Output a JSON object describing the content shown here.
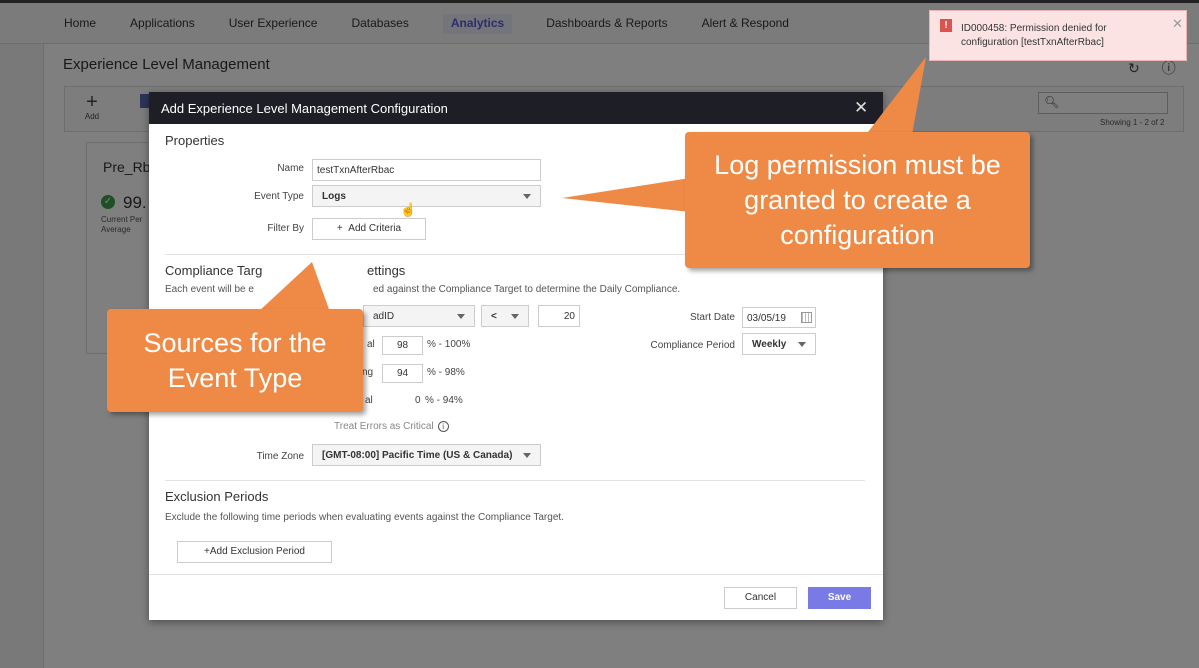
{
  "nav": {
    "items": [
      "Home",
      "Applications",
      "User Experience",
      "Databases",
      "Analytics",
      "Dashboards & Reports",
      "Alert & Respond"
    ],
    "active": "Analytics"
  },
  "page": {
    "title": "Experience Level Management",
    "add_label": "Add",
    "showing": "Showing 1 - 2 of 2"
  },
  "card": {
    "name": "Pre_Rb",
    "value": "99.",
    "sub_line1": "Current Per",
    "sub_line2": "Average"
  },
  "modal": {
    "title": "Add Experience Level Management Configuration",
    "properties_title": "Properties",
    "name_label": "Name",
    "name_value": "testTxnAfterRbac",
    "event_type_label": "Event Type",
    "event_type_value": "Logs",
    "filter_by_label": "Filter By",
    "add_criteria": "Add Criteria",
    "compliance_title": "Compliance Target Settings",
    "compliance_title_visible_left": "Compliance Targ",
    "compliance_title_visible_right": "ettings",
    "compliance_desc_left": "Each event will be e",
    "compliance_desc_right": "ed against the Compliance Target to determine the Daily Compliance.",
    "field_select_value": "adID",
    "operator_value": "<",
    "threshold_value": "20",
    "normal_partial": "al",
    "normal_value": "98",
    "normal_range": "% - 100%",
    "warning_partial": "ng",
    "warning_value": "94",
    "warning_range": "% - 98%",
    "critical_partial": "al",
    "critical_value": "0",
    "critical_range": "% - 94%",
    "treat_errors": "Treat Errors as Critical",
    "start_date_label": "Start Date",
    "start_date_value": "03/05/19",
    "compliance_period_label": "Compliance Period",
    "compliance_period_value": "Weekly",
    "time_zone_label": "Time Zone",
    "time_zone_value": "[GMT-08:00] Pacific Time (US & Canada)",
    "exclusion_title": "Exclusion Periods",
    "exclusion_desc": "Exclude the following time periods when evaluating events against the Compliance Target.",
    "add_exclusion": "Add Exclusion Period",
    "cancel": "Cancel",
    "save": "Save"
  },
  "toast": {
    "message": "ID000458: Permission denied for configuration [testTxnAfterRbac]"
  },
  "callouts": {
    "log_permission": "Log permission must be granted to create a configuration",
    "log_permission_lines": [
      "Log permission must be",
      "granted to create a",
      "configuration"
    ],
    "sources_lines": [
      "Sources for the",
      "Event Type"
    ]
  },
  "colors": {
    "accent": "#7a7ae6",
    "callout": "#ef8a46",
    "error_bg": "#fbe3e3",
    "error_icon": "#d9534f",
    "success": "#3c9f4a",
    "modal_header": "#1e1e26"
  },
  "icons": [
    "plus-icon",
    "search-icon",
    "refresh-icon",
    "help-icon",
    "check-circle-icon",
    "close-icon",
    "calendar-icon",
    "info-icon",
    "error-icon",
    "hand-cursor-icon",
    "chevron-down-icon"
  ]
}
